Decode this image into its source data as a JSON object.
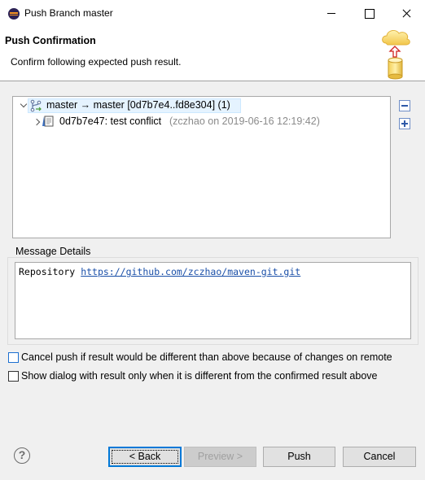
{
  "window": {
    "title": "Push Branch master",
    "icon": "eclipse-icon"
  },
  "header": {
    "title": "Push Confirmation",
    "description": "Confirm following expected push result.",
    "banner_icon": "push-to-cloud-icon"
  },
  "tree": {
    "ref_update": {
      "label": "master → master [0d7b7e4..fd8e304] (1)",
      "icon": "branch-icon",
      "expanded": true,
      "selected": true
    },
    "commits": [
      {
        "label": "0d7b7e47: test conflict",
        "detail": "(zczhao on 2019-06-16 12:19:42)",
        "icon": "commit-icon",
        "expanded": false
      }
    ],
    "collapse_all_icon": "collapse-all-icon",
    "expand_all_icon": "expand-all-icon"
  },
  "message_details": {
    "label": "Message Details",
    "prefix": "Repository",
    "repository_url": "https://github.com/zczhao/maven-git.git"
  },
  "options": {
    "cancel_if_different": {
      "label": "Cancel push if result would be different than above because of changes on remote",
      "checked": false
    },
    "show_only_if_different": {
      "label": "Show dialog with result only when it is different from the confirmed result above",
      "checked": false
    }
  },
  "buttons": {
    "help": "?",
    "back": "< Back",
    "preview": "Preview >",
    "push": "Push",
    "cancel": "Cancel"
  }
}
